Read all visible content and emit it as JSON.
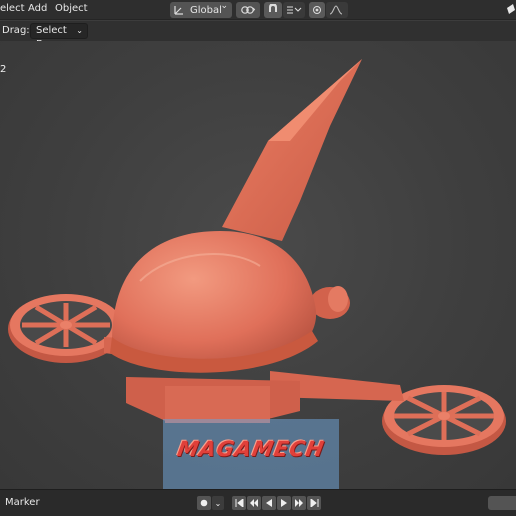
{
  "header": {
    "menu": [
      "elect",
      "Add",
      "Object"
    ],
    "orientation_label": "Global",
    "chevron": "⌄"
  },
  "tool_settings": {
    "drag_label": "Drag:",
    "drag_value": "Select Box"
  },
  "viewport": {
    "info_text": "2",
    "watermark": "MAGAMECH",
    "model_color": "#e8735a",
    "background_color": "#404040"
  },
  "timeline": {
    "marker_label": "Marker",
    "playback_icons": [
      "jump-start-icon",
      "prev-keyframe-icon",
      "play-reverse-icon",
      "play-icon",
      "next-keyframe-icon",
      "jump-end-icon"
    ]
  },
  "icons": {
    "transform_orientation": "orientation-axes-icon",
    "pivot": "link-icon",
    "snap": "snap-magnet-icon",
    "snap_target": "snap-increment-icon",
    "proportional": "proportional-edit-icon",
    "falloff": "falloff-curve-icon",
    "record": "record-icon"
  }
}
